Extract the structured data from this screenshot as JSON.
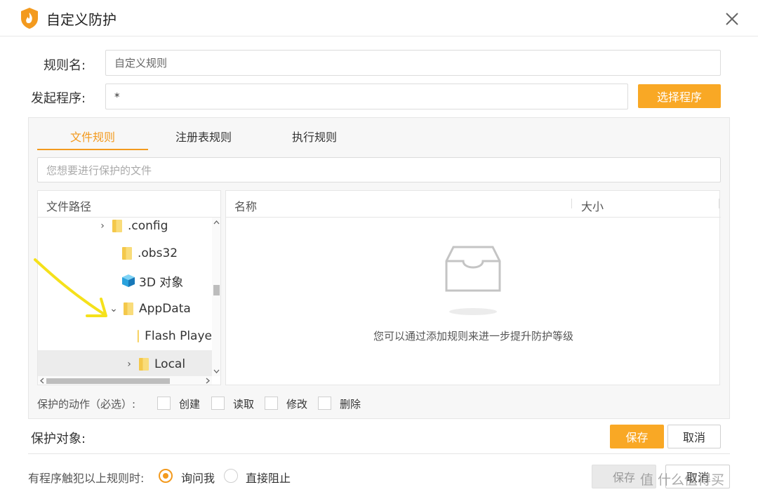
{
  "window": {
    "title": "自定义防护"
  },
  "form": {
    "rule_name_label": "规则名:",
    "rule_name_placeholder": "自定义规则",
    "program_label": "发起程序:",
    "program_value": "*",
    "select_program_label": "选择程序"
  },
  "tabs": [
    {
      "label": "文件规则",
      "active": true
    },
    {
      "label": "注册表规则",
      "active": false
    },
    {
      "label": "执行规则",
      "active": false
    }
  ],
  "file_input_placeholder": "您想要进行保护的文件",
  "tree": {
    "header": "文件路径",
    "items": [
      {
        "label": ".config",
        "chevron": "›",
        "icon": "folder-icon"
      },
      {
        "label": ".obs32",
        "chevron": "",
        "icon": "folder-icon"
      },
      {
        "label": "3D 对象",
        "chevron": "",
        "icon": "3d-cube-icon"
      },
      {
        "label": "AppData",
        "chevron": "⌄",
        "icon": "folder-icon"
      },
      {
        "label": "Flash Playe",
        "chevron": "",
        "icon": "folder-icon"
      },
      {
        "label": "Local",
        "chevron": "›",
        "icon": "folder-icon"
      }
    ]
  },
  "list": {
    "col_name": "名称",
    "col_size": "大小",
    "empty_text": "您可以通过添加规则来进一步提升防护等级"
  },
  "actions": {
    "label": "保护的动作（必选）:",
    "items": [
      "创建",
      "读取",
      "修改",
      "删除"
    ]
  },
  "protect_target_label": "保护对象:",
  "inner_save": "保存",
  "inner_cancel": "取消",
  "trigger": {
    "label": "有程序触犯以上规则时:",
    "options": [
      "询问我",
      "直接阻止"
    ],
    "selected": "询问我"
  },
  "footer_save": "保存",
  "footer_cancel": "取消",
  "watermark": "值 什么值得买",
  "colors": {
    "accent": "#f39a1e",
    "annotation_arrow": "#f5e11b"
  }
}
